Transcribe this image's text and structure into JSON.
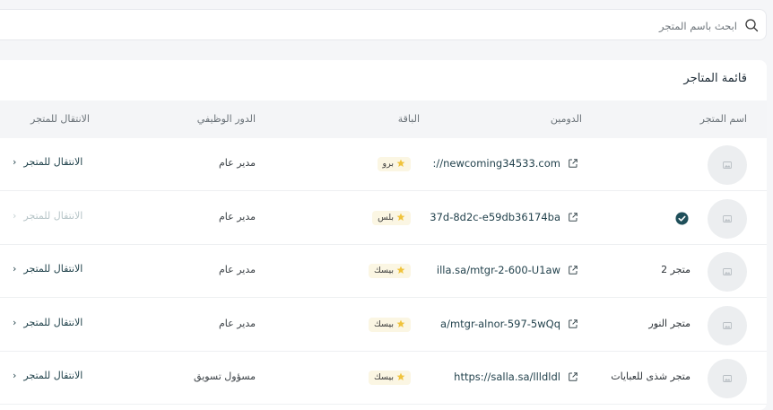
{
  "search": {
    "placeholder": "ابحث باسم المتجر",
    "value": "",
    "icon": "search-icon"
  },
  "card": {
    "title": "قائمة المتاجر"
  },
  "table": {
    "columns": {
      "store_name": "اسم المتجر",
      "domain": "الدومين",
      "plan": "الباقة",
      "role": "الدور الوظيفي",
      "goto": "الانتقال للمتجر"
    },
    "rows": [
      {
        "name": "",
        "verified": false,
        "domain": "://newcoming34533.com",
        "plan": "برو",
        "role": "مدير عام",
        "goto": "الانتقال للمتجر",
        "goto_enabled": true
      },
      {
        "name": "",
        "verified": true,
        "domain": "37d-8d2c-e59db36174ba",
        "plan": "بلس",
        "role": "مدير عام",
        "goto": "الانتقال للمتجر",
        "goto_enabled": false
      },
      {
        "name": "متجر 2",
        "verified": false,
        "domain": "illa.sa/mtgr-2-600-U1aw",
        "plan": "بيسك",
        "role": "مدير عام",
        "goto": "الانتقال للمتجر",
        "goto_enabled": true
      },
      {
        "name": "متجر النور",
        "verified": false,
        "domain": "a/mtgr-alnor-597-5wQq",
        "plan": "بيسك",
        "role": "مدير عام",
        "goto": "الانتقال للمتجر",
        "goto_enabled": true
      },
      {
        "name": "متجر شذى للعبايات",
        "verified": false,
        "domain": "https://salla.sa/llldldl",
        "plan": "بيسك",
        "role": "مسؤول تسويق",
        "goto": "الانتقال للمتجر",
        "goto_enabled": true
      }
    ]
  },
  "colors": {
    "accent": "#1d3f48",
    "badge_bg": "#fbf6e3",
    "star": "#f0c33c",
    "verified": "#1f4f5a",
    "header_bg": "#f4f5f7"
  }
}
